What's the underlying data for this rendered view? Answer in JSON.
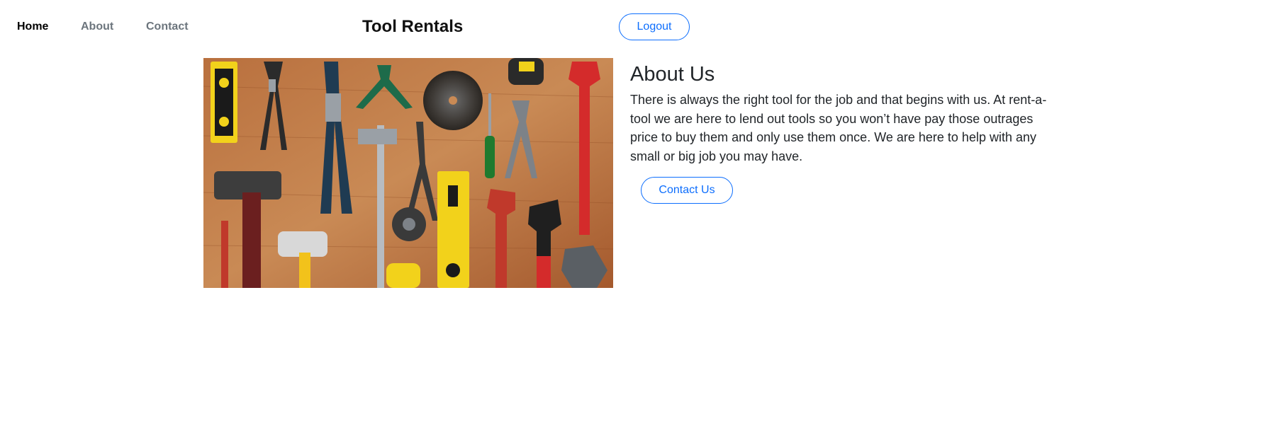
{
  "nav": {
    "home": "Home",
    "about": "About",
    "contact": "Contact"
  },
  "header": {
    "title": "Tool Rentals",
    "logout_label": "Logout"
  },
  "about": {
    "title": "About Us",
    "text": "There is always the right tool for the job and that begins with us. At rent-a-tool we are here to lend out tools so you won’t have pay those outrages price to buy them and only use them once. We are here to help with any small or big job you may have.",
    "contact_label": "Contact Us"
  },
  "colors": {
    "accent": "#0d6efd",
    "nav_active": "#000000",
    "nav_inactive": "#6c757d",
    "text": "#212529"
  }
}
